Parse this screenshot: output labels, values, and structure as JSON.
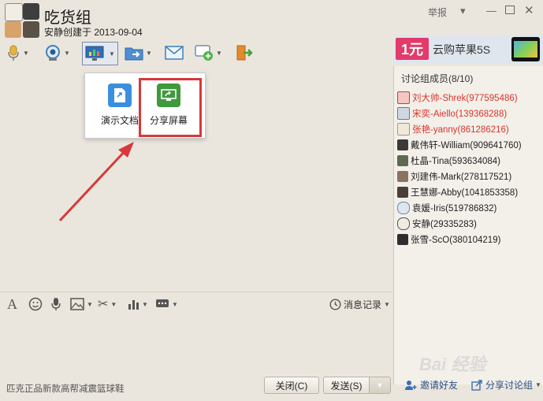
{
  "header": {
    "title": "吃货组",
    "subtitle": "安静创建于 2013-09-04",
    "report": "举报"
  },
  "ad": {
    "price": "1元",
    "text": "云购苹果5S"
  },
  "sidebar": {
    "members_title": "讨论组成员(8/10)",
    "members": [
      {
        "name": "刘大帅-Shrek(977595486)",
        "color": "#d9342b"
      },
      {
        "name": "宋奕-Aiello(139368288)",
        "color": "#d9342b"
      },
      {
        "name": "张艳-yanny(861286216)",
        "color": "#d9342b"
      },
      {
        "name": "戴伟轩-William(909641760)",
        "color": "#222222"
      },
      {
        "name": "杜晶-Tina(593634084)",
        "color": "#222222"
      },
      {
        "name": "刘建伟-Mark(278117521)",
        "color": "#222222"
      },
      {
        "name": "王慧娜-Abby(1041853358)",
        "color": "#222222"
      },
      {
        "name": "袁媛-Iris(519786832)",
        "color": "#222222"
      },
      {
        "name": "安静(29335283)",
        "color": "#222222"
      },
      {
        "name": "张雪-ScO(380104219)",
        "color": "#222222"
      }
    ],
    "invite": "邀请好友",
    "share_group": "分享讨论组"
  },
  "popup": {
    "present_doc": "演示文档",
    "share_screen": "分享屏幕"
  },
  "input": {
    "history": "消息记录"
  },
  "footer": {
    "ad_text": "匹克正品新款高帮减震篮球鞋",
    "close": "关闭(C)",
    "send": "发送(S)"
  },
  "watermark": "Bai 经验"
}
